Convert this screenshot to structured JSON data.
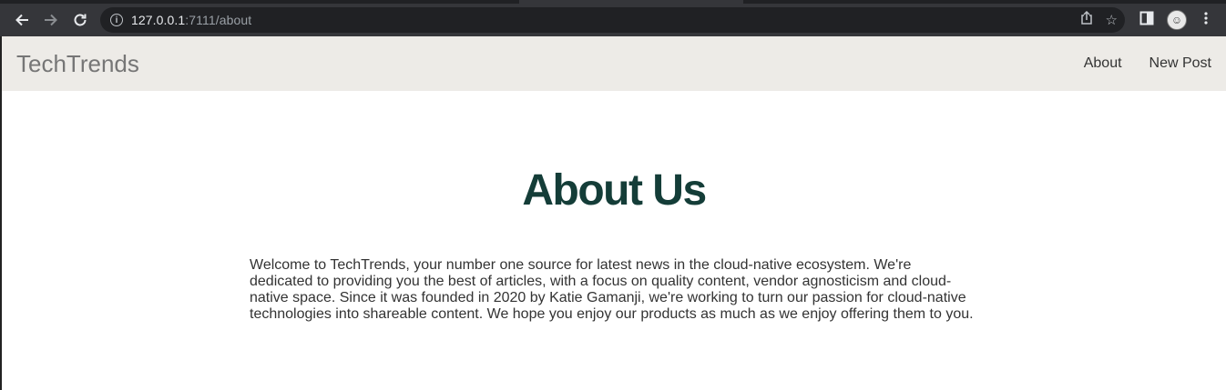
{
  "browser": {
    "url_host": "127.0.0.1",
    "url_path": ":7111/about"
  },
  "site": {
    "brand": "TechTrends",
    "nav": {
      "about": "About",
      "new_post": "New Post"
    }
  },
  "main": {
    "title": "About Us",
    "body": "Welcome to TechTrends, your number one source for latest news in the cloud-native ecosystem. We're dedicated to providing you the best of articles, with a focus on quality content, vendor agnosticism and cloud-native space. Since it was founded in 2020 by Katie Gamanji, we're working to turn our passion for cloud-native technologies into shareable content. We hope you enjoy our products as much as we enjoy offering them to you."
  },
  "colors": {
    "navbar_bg": "#edebe7",
    "heading": "#143d38",
    "brand": "#767676"
  }
}
